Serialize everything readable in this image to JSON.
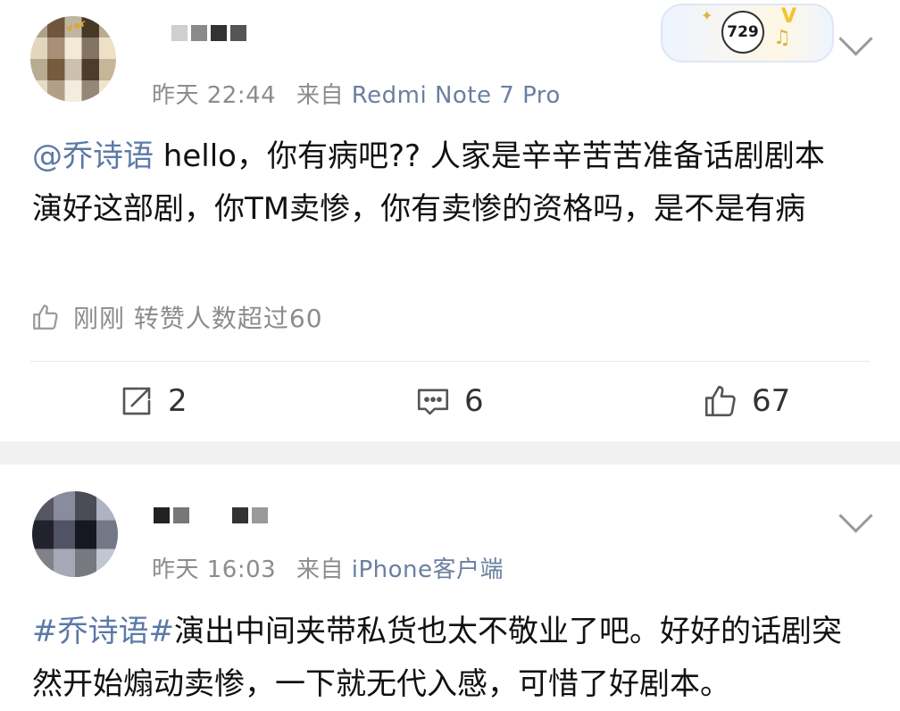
{
  "posts": [
    {
      "time": "昨天 22:44",
      "from_prefix": "来自",
      "source": "Redmi Note 7 Pro",
      "badge_number": "729",
      "mention": "@乔诗语",
      "text": " hello，你有病吧?? 人家是辛辛苦苦准备话剧剧本演好这部剧，你TM卖惨，你有卖惨的资格吗，是不是有病",
      "like_row_text": "刚刚 转赞人数超过60",
      "actions": {
        "repost": "2",
        "comment": "6",
        "like": "67"
      }
    },
    {
      "time": "昨天 16:03",
      "from_prefix": "来自",
      "source": "iPhone客户端",
      "hashtag": "#乔诗语#",
      "text": "演出中间夹带私货也太不敬业了吧。好好的话剧突然开始煽动卖惨，一下就无代入感，可惜了好剧本。"
    }
  ],
  "icons": [
    "chevron-down-icon",
    "thumbs-up-icon",
    "repost-icon",
    "comment-icon"
  ],
  "colors": {
    "link": "#5b79a8",
    "meta": "#8c8c8c",
    "separator": "#f1f1f1"
  }
}
